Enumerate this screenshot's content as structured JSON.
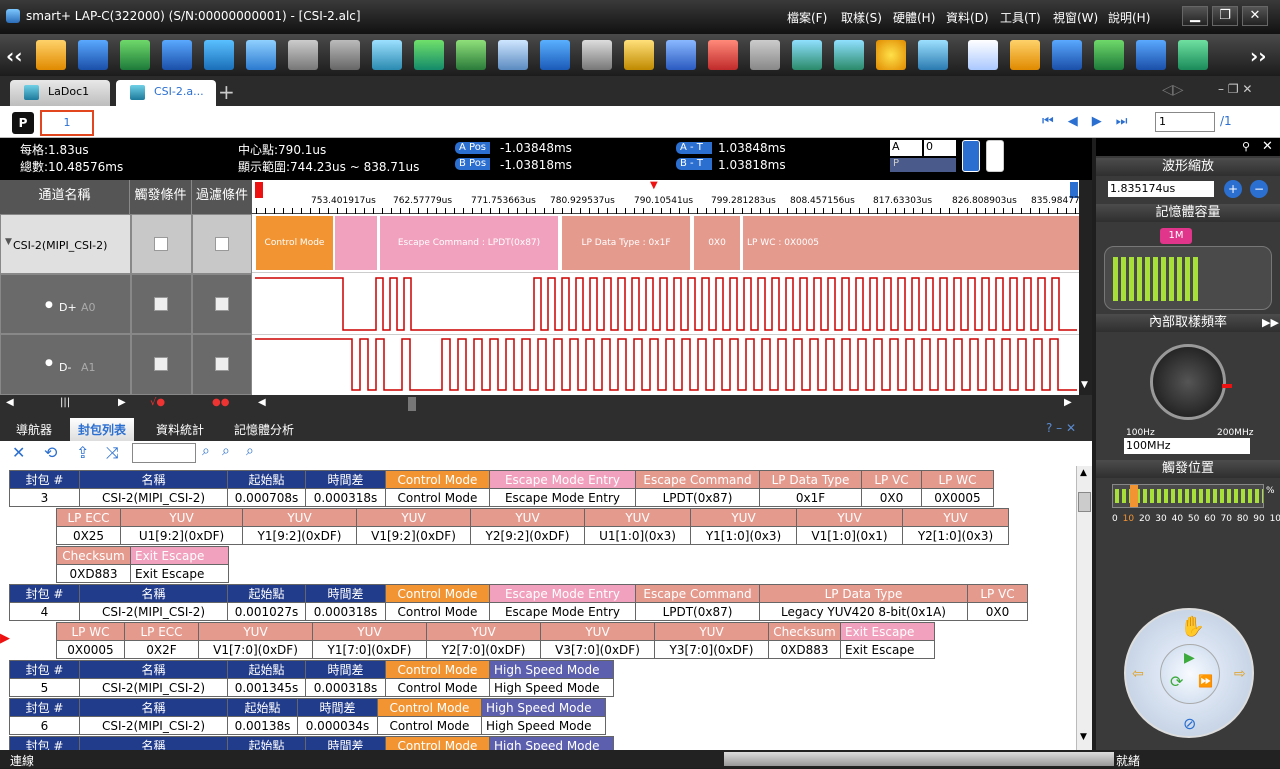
{
  "app": {
    "title": "smart+  LAP-C(322000) (S/N:00000000001) - [CSI-2.alc]"
  },
  "menu": [
    "檔案(F)",
    "取樣(S)",
    "硬體(H)",
    "資料(D)",
    "工具(T)",
    "視窗(W)",
    "說明(H)"
  ],
  "window_buttons": [
    "▁",
    "❐",
    "✕"
  ],
  "tabs": [
    {
      "label": "LaDoc1"
    },
    {
      "label": "CSI-2.a..."
    }
  ],
  "tab_add": "+",
  "pagebar": {
    "page_label": "P",
    "page_value": "1",
    "page_input": "1",
    "page_total": "/1"
  },
  "info": {
    "grid": "每格:1.83us",
    "total": "總數:10.48576ms",
    "center": "中心點:790.1us",
    "range": "顯示範圍:744.23us ~ 838.71us",
    "apos_label": "A Pos",
    "apos": "-1.03848ms",
    "bpos_label": "B Pos",
    "bpos": "-1.03818ms",
    "at_label": "A - T",
    "at": "1.03848ms",
    "bt_label": "B - T",
    "bt": "1.03818ms",
    "sel_a": "A",
    "sel_0": "0",
    "p_label": "P"
  },
  "channels": {
    "header_name": "通道名稱",
    "header_trigger": "觸發條件",
    "header_filter": "過濾條件",
    "bus": "CSI-2(MIPI_CSI-2)",
    "dplus": "D+",
    "dplus_pin": "A0",
    "dminus": "D-",
    "dminus_pin": "A1"
  },
  "ruler": {
    "ticks": [
      "753.401917us",
      "762.57779us",
      "771.753663us",
      "780.929537us",
      "790.10541us",
      "799.281283us",
      "808.457156us",
      "817.63303us",
      "826.808903us",
      "835.98477"
    ]
  },
  "bus_segments": [
    {
      "label": "Control Mode",
      "color": "#f39432"
    },
    {
      "label": "",
      "color": "#f1a1bd"
    },
    {
      "label": "Escape Command : LPDT(0x87)",
      "color": "#f1a1bd"
    },
    {
      "label": "LP Data Type : 0x1F",
      "color": "#e59a8e"
    },
    {
      "label": "0X0",
      "color": "#e59a8e"
    },
    {
      "label": "LP WC : 0X0005",
      "color": "#e59a8e"
    }
  ],
  "side": {
    "zoom_title": "波形縮放",
    "zoom_value": "1.835174us",
    "memory_title": "記憶體容量",
    "memory_badge": "1M",
    "rate_title": "內部取樣頻率",
    "rate_min": "100Hz",
    "rate_max": "200MHz",
    "rate_value": "100MHz",
    "trigger_title": "觸發位置",
    "trigger_scale": [
      "0",
      "10",
      "20",
      "30",
      "40",
      "50",
      "60",
      "70",
      "80",
      "90",
      "100"
    ],
    "trigger_pct": "%",
    "trigger_value": 10,
    "memory_level": 0.58
  },
  "lower": {
    "tabs": [
      "導航器",
      "封包列表",
      "資料統計",
      "記憶體分析"
    ],
    "help": "? – ✕"
  },
  "packets": {
    "hdr": [
      "封包 #",
      "名稱",
      "起始點",
      "時間差"
    ],
    "rows": [
      {
        "num": "3",
        "name": "CSI-2(MIPI_CSI-2)",
        "start": "0.000708s",
        "delta": "0.000318s",
        "f1": [
          [
            "Control Mode",
            "Control Mode"
          ],
          [
            "Escape Mode Entry",
            "Escape Mode Entry"
          ],
          [
            "Escape Command",
            "LPDT(0x87)"
          ],
          [
            "LP Data Type",
            "0x1F"
          ],
          [
            "LP VC",
            "0X0"
          ],
          [
            "LP WC",
            "0X0005"
          ]
        ],
        "f2": [
          [
            "LP ECC",
            "0X25"
          ],
          [
            "YUV",
            "U1[9:2](0xDF)"
          ],
          [
            "YUV",
            "Y1[9:2](0xDF)"
          ],
          [
            "YUV",
            "V1[9:2](0xDF)"
          ],
          [
            "YUV",
            "Y2[9:2](0xDF)"
          ],
          [
            "YUV",
            "U1[1:0](0x3)"
          ],
          [
            "YUV",
            "Y1[1:0](0x3)"
          ],
          [
            "YUV",
            "V1[1:0](0x1)"
          ],
          [
            "YUV",
            "Y2[1:0](0x3)"
          ]
        ],
        "f3": [
          [
            "Checksum",
            "0XD883"
          ],
          [
            "Exit Escape",
            "Exit Escape"
          ]
        ]
      },
      {
        "num": "4",
        "name": "CSI-2(MIPI_CSI-2)",
        "start": "0.001027s",
        "delta": "0.000318s",
        "f1": [
          [
            "Control Mode",
            "Control Mode"
          ],
          [
            "Escape Mode Entry",
            "Escape Mode Entry"
          ],
          [
            "Escape Command",
            "LPDT(0x87)"
          ],
          [
            "LP Data Type",
            "Legacy YUV420 8-bit(0x1A)"
          ],
          [
            "LP VC",
            "0X0"
          ]
        ],
        "f2": [
          [
            "LP WC",
            "0X0005"
          ],
          [
            "LP ECC",
            "0X2F"
          ],
          [
            "YUV",
            "V1[7:0](0xDF)"
          ],
          [
            "YUV",
            "Y1[7:0](0xDF)"
          ],
          [
            "YUV",
            "Y2[7:0](0xDF)"
          ],
          [
            "YUV",
            "V3[7:0](0xDF)"
          ],
          [
            "YUV",
            "Y3[7:0](0xDF)"
          ],
          [
            "Checksum",
            "0XD883"
          ],
          [
            "Exit Escape",
            "Exit Escape"
          ]
        ]
      },
      {
        "num": "5",
        "name": "CSI-2(MIPI_CSI-2)",
        "start": "0.001345s",
        "delta": "0.000318s",
        "f1": [
          [
            "Control Mode",
            "Control Mode"
          ],
          [
            "High Speed Mode",
            "High Speed Mode"
          ]
        ]
      },
      {
        "num": "6",
        "name": "CSI-2(MIPI_CSI-2)",
        "start": "0.00138s",
        "delta": "0.000034s",
        "f1": [
          [
            "Control Mode",
            "Control Mode"
          ],
          [
            "High Speed Mode",
            "High Speed Mode"
          ]
        ]
      },
      {
        "num": "",
        "name": "",
        "start": "",
        "delta": "",
        "f1": [
          [
            "Control Mode",
            ""
          ],
          [
            "High Speed Mode",
            ""
          ]
        ]
      }
    ]
  },
  "status": {
    "left": "連線",
    "right": "就緒"
  }
}
